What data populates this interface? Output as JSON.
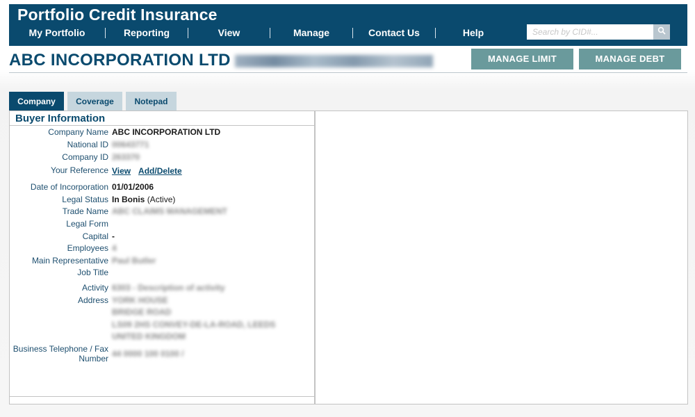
{
  "header": {
    "title": "Portfolio Credit Insurance",
    "nav": [
      "My Portfolio",
      "Reporting",
      "View",
      "Manage",
      "Contact Us",
      "Help"
    ],
    "search_placeholder": "Search by CID#..."
  },
  "company": {
    "name": "ABC INCORPORATION LTD",
    "actions": {
      "manage_limit": "MANAGE LIMIT",
      "manage_debt": "MANAGE DEBT"
    }
  },
  "tabs": [
    "Company",
    "Coverage",
    "Notepad"
  ],
  "buyer_info": {
    "title": "Buyer Information",
    "labels": {
      "company_name": "Company Name",
      "national_id": "National ID",
      "company_id": "Company ID",
      "your_reference": "Your Reference",
      "date_of_incorporation": "Date of Incorporation",
      "legal_status": "Legal Status",
      "trade_name": "Trade Name",
      "legal_form": "Legal Form",
      "capital": "Capital",
      "employees": "Employees",
      "main_representative": "Main Representative",
      "job_title": "Job Title",
      "activity": "Activity",
      "address": "Address",
      "telephone_line1": "Business Telephone / Fax",
      "telephone_line2": "Number"
    },
    "values": {
      "company_name": "ABC INCORPORATION LTD",
      "national_id": "00643771",
      "company_id": "263370",
      "reference_view": "View",
      "reference_add": "Add/Delete",
      "date_of_incorporation": "01/01/2006",
      "legal_status": "In Bonis",
      "legal_status_note": "(Active)",
      "trade_name": "ABC CLAIMS MANAGEMENT",
      "capital": "-",
      "employees": "4",
      "main_representative": "Paul Butler",
      "activity": "6303 - Description of activity",
      "address_line1": "YORK HOUSE",
      "address_line2": "BRIDGE ROAD",
      "address_line3": "LS09 2HS CONVEY-DE-LA-ROAD, LEEDS",
      "address_line4": "UNITED KINGDOM",
      "telephone": "44 0000 100 0100 /"
    }
  },
  "icons": {
    "search": "search-icon"
  },
  "colors": {
    "brand": "#0a4a6e",
    "action_button": "#6a9a9c",
    "tab_inactive": "#c6d6de"
  }
}
